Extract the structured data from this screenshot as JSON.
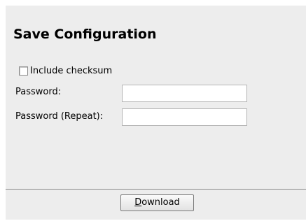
{
  "dialog": {
    "title": "Save Configuration",
    "include_checksum": {
      "label": "Include checksum",
      "checked": false
    },
    "password": {
      "label": "Password:",
      "value": ""
    },
    "password_repeat": {
      "label": "Password (Repeat):",
      "value": ""
    },
    "download_button": {
      "mnemonic": "D",
      "rest": "ownload"
    }
  }
}
